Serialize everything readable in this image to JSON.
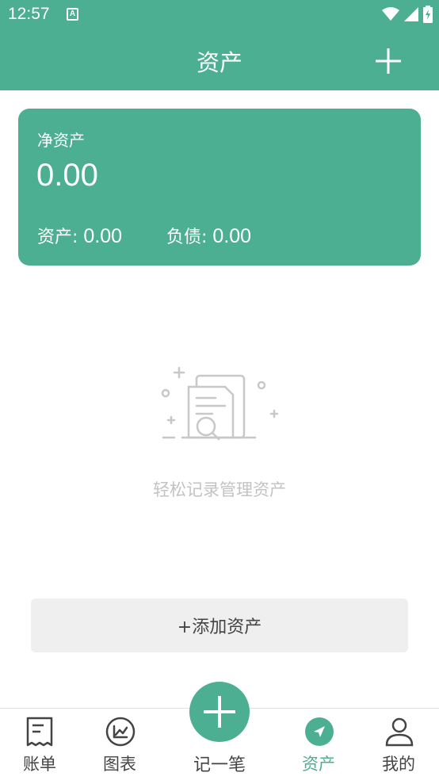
{
  "status_bar": {
    "time": "12:57",
    "notification_glyph": "A"
  },
  "header": {
    "title": "资产"
  },
  "summary": {
    "net_label": "净资产",
    "net_value": "0.00",
    "assets_label": "资产:",
    "assets_value": "0.00",
    "liabilities_label": "负债:",
    "liabilities_value": "0.00"
  },
  "empty_state": {
    "message": "轻松记录管理资产"
  },
  "add_asset": {
    "label": "+添加资产"
  },
  "nav": {
    "items": [
      {
        "label": "账单",
        "icon": "bill-icon"
      },
      {
        "label": "图表",
        "icon": "chart-icon"
      },
      {
        "label": "记一笔",
        "icon": "plus-icon"
      },
      {
        "label": "资产",
        "icon": "asset-icon"
      },
      {
        "label": "我的",
        "icon": "person-icon"
      }
    ]
  },
  "colors": {
    "brand": "#4caf91",
    "empty_text": "#c3c3c3",
    "button_bg": "#efefef"
  }
}
